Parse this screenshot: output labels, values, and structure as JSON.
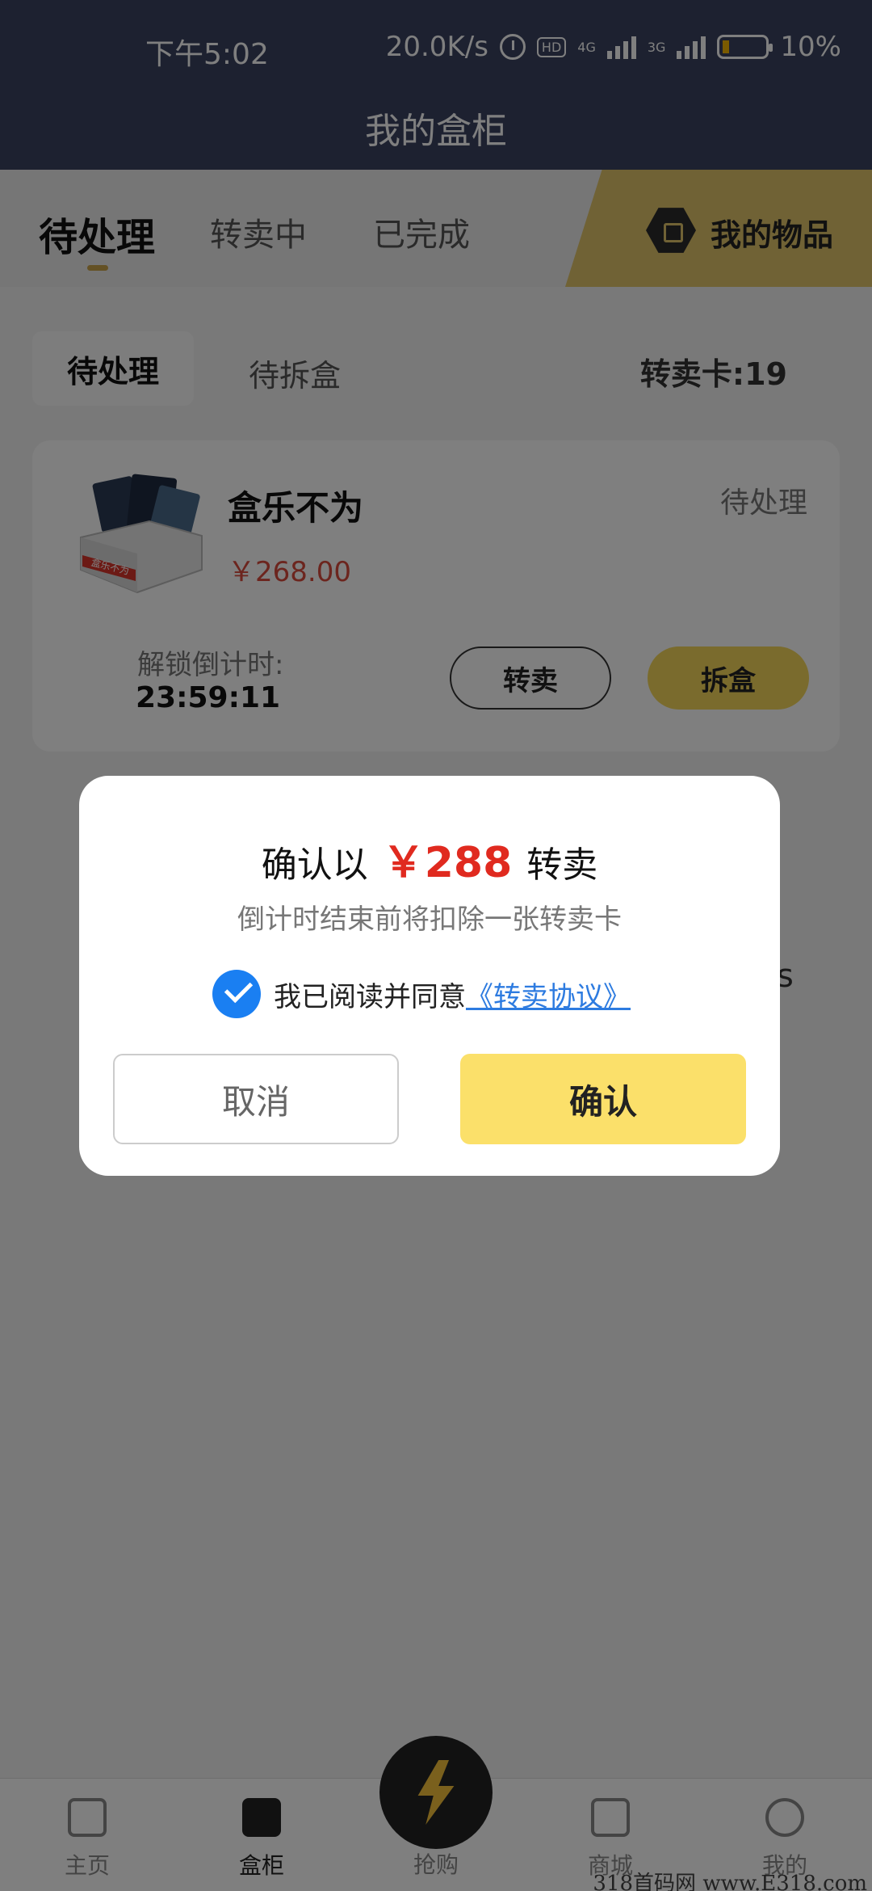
{
  "status_bar": {
    "time": "下午5:02",
    "net_speed": "20.0K/s",
    "network_1": "4G",
    "network_2": "3G",
    "hd": "HD",
    "battery": "10%"
  },
  "header": {
    "title": "我的盒柜"
  },
  "tabs": [
    {
      "label": "待处理",
      "active": true
    },
    {
      "label": "转卖中",
      "active": false
    },
    {
      "label": "已完成",
      "active": false
    }
  ],
  "my_items": {
    "label": "我的物品"
  },
  "subtabs": [
    {
      "label": "待处理",
      "active": true
    },
    {
      "label": "待拆盒",
      "active": false
    }
  ],
  "resale_card_count": "转卖卡:19",
  "card": {
    "name": "盒乐不为",
    "price": "￥268.00",
    "status": "待处理",
    "box_text": "盒乐不为",
    "countdown_label": "解锁倒计时:",
    "countdown": "23:59:11",
    "resell_label": "转卖",
    "unbox_label": "拆盒"
  },
  "bg_fragment": "s",
  "dialog": {
    "title_prefix": "确认以",
    "amount": "￥288",
    "title_suffix": "转卖",
    "subtitle": "倒计时结束前将扣除一张转卖卡",
    "agree_text": "我已阅读并同意",
    "agree_link": "《转卖协议》",
    "checked": true,
    "cancel_label": "取消",
    "confirm_label": "确认"
  },
  "bottom_nav": [
    {
      "label": "主页",
      "icon": "home-icon",
      "active": false
    },
    {
      "label": "盒柜",
      "icon": "bag-icon",
      "active": true
    },
    {
      "label": "抢购",
      "icon": "lightning-icon",
      "active": false
    },
    {
      "label": "商城",
      "icon": "shop-icon",
      "active": false
    },
    {
      "label": "我的",
      "icon": "profile-icon",
      "active": false
    }
  ],
  "watermark": "318首码网 www.E318.com",
  "colors": {
    "header_bg": "#3b4360",
    "accent_yellow": "#f5d75a",
    "price_red": "#e02a1f",
    "link_blue": "#2d7be0"
  }
}
